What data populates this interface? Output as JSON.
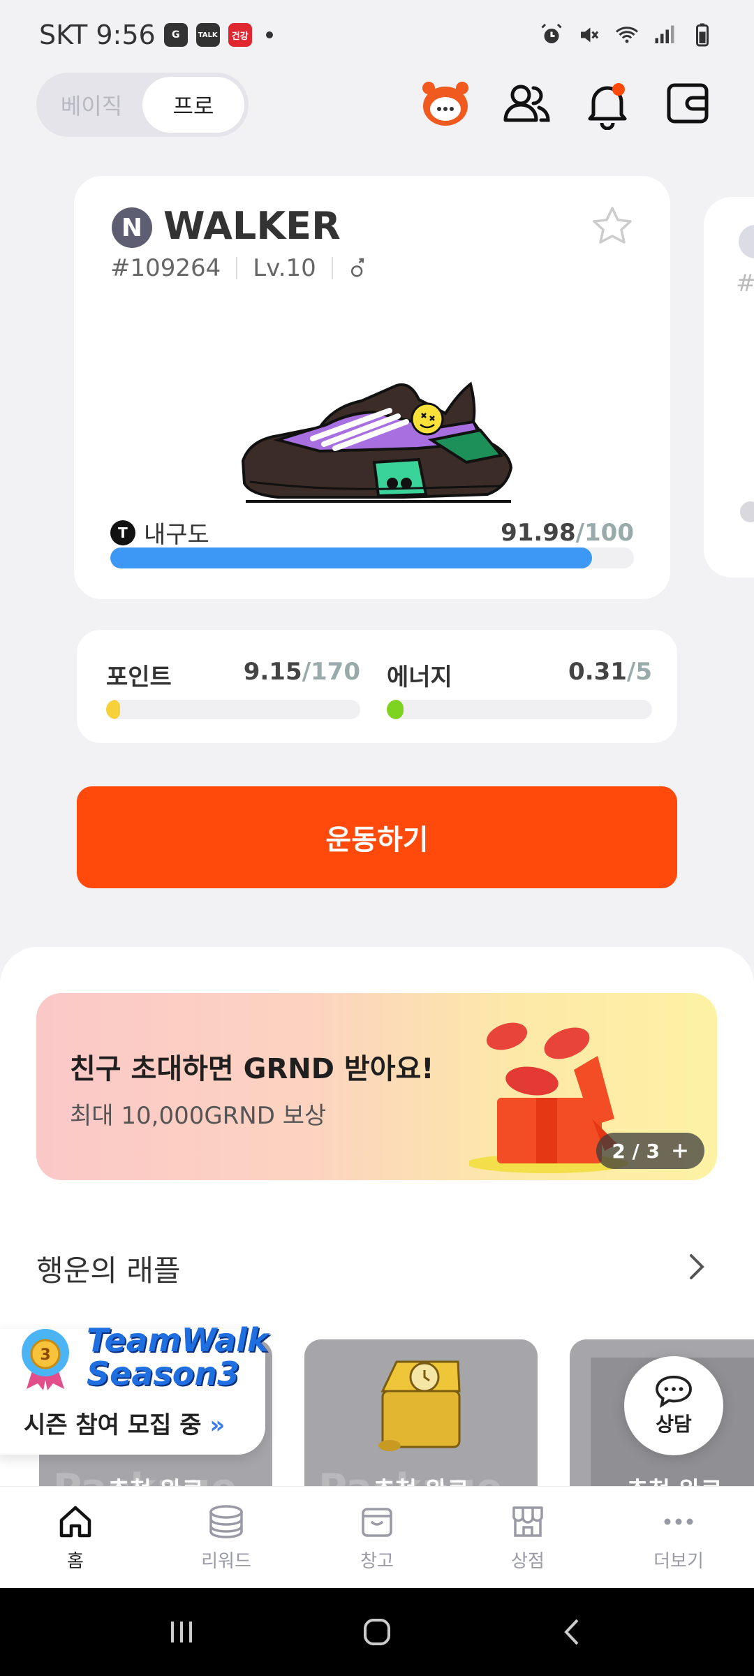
{
  "status_bar": {
    "carrier_time": "SKT 9:56",
    "app_icon_1": "G",
    "app_icon_2": "TALK",
    "app_icon_3": "건강"
  },
  "header": {
    "mode_basic": "베이직",
    "mode_pro": "프로"
  },
  "sneaker": {
    "badge": "N",
    "name": "WALKER",
    "id": "#109264",
    "level": "Lv.10",
    "durability_label": "내구도",
    "durability_value": "91.98",
    "durability_max": "/100",
    "durability_fraction": 0.9198,
    "durability_color": "#3d97f5"
  },
  "stats": {
    "points_label": "포인트",
    "points_value": "9.15",
    "points_max": "/170",
    "points_fraction": 0.054,
    "points_color": "#f7d13b",
    "energy_label": "에너지",
    "energy_value": "0.31",
    "energy_max": "/5",
    "energy_fraction": 0.062,
    "energy_color": "#7ed321"
  },
  "primary_button": {
    "label": "운동하기",
    "color": "#ff4a0c"
  },
  "banner": {
    "title": "친구 초대하면 GRND 받아요!",
    "subtitle": "최대 10,000GRND 보상",
    "pager": "2 / 3"
  },
  "raffle": {
    "title": "행운의 래플",
    "cards": [
      {
        "status": "추첨 완료",
        "watermark": "Package"
      },
      {
        "status": "추첨 완료",
        "watermark": "Package"
      },
      {
        "status": "추첨 완료",
        "watermark": ""
      }
    ]
  },
  "season_popup": {
    "logo_line1": "TeamWalk",
    "logo_line2": "Season3",
    "medal_number": "3",
    "text": "시즌 참여 모집 중"
  },
  "chat_fab": {
    "label": "상담"
  },
  "tabs": [
    {
      "label": "홈",
      "icon": "home-icon"
    },
    {
      "label": "리워드",
      "icon": "coins-icon"
    },
    {
      "label": "창고",
      "icon": "box-icon"
    },
    {
      "label": "상점",
      "icon": "store-icon"
    },
    {
      "label": "더보기",
      "icon": "more-icon"
    }
  ]
}
